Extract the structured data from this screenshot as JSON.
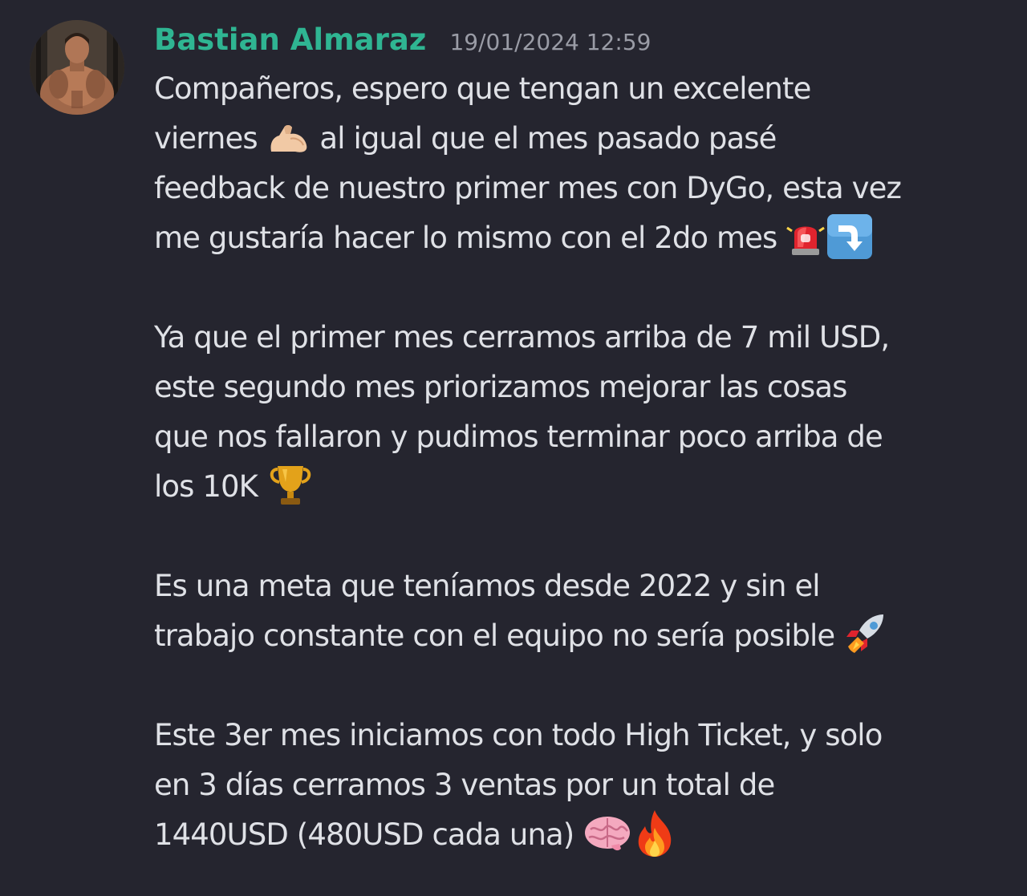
{
  "message": {
    "author": "Bastian Almaraz",
    "timestamp": "19/01/2024 12:59",
    "paragraphs": [
      {
        "lines": [
          "Compañeros, espero que tengan un excelente",
          "viernes ",
          " al igual que el mes pasado pasé",
          "feedback de nuestro primer mes con DyGo, esta vez",
          "me gustaría hacer lo mismo con el 2do mes "
        ]
      },
      {
        "lines": [
          "Ya que el primer mes cerramos arriba de 7 mil USD,",
          "este segundo mes priorizamos mejorar las cosas",
          "que nos fallaron y pudimos terminar poco arriba de",
          "los 10K "
        ]
      },
      {
        "lines": [
          "Es una meta que teníamos desde 2022 y sin el",
          "trabajo constante con el equipo no sería posible "
        ]
      },
      {
        "lines": [
          "Este 3er mes iniciamos con todo High Ticket, y solo",
          "en 3 días cerramos 3 ventas por un total de",
          "1440USD (480USD cada una) "
        ]
      }
    ]
  },
  "icons": {
    "avatar": "avatar-photo",
    "emoji_1": "flexed-biceps-icon",
    "emoji_2": "police-light-icon",
    "emoji_3": "arrow-down-right-icon",
    "emoji_4": "trophy-icon",
    "emoji_5": "rocket-icon",
    "emoji_6": "brain-icon",
    "emoji_7": "fire-icon"
  },
  "colors": {
    "background": "#25252f",
    "author": "#2fb592",
    "timestamp": "#9a9ca6",
    "text": "#dfe1e6"
  }
}
